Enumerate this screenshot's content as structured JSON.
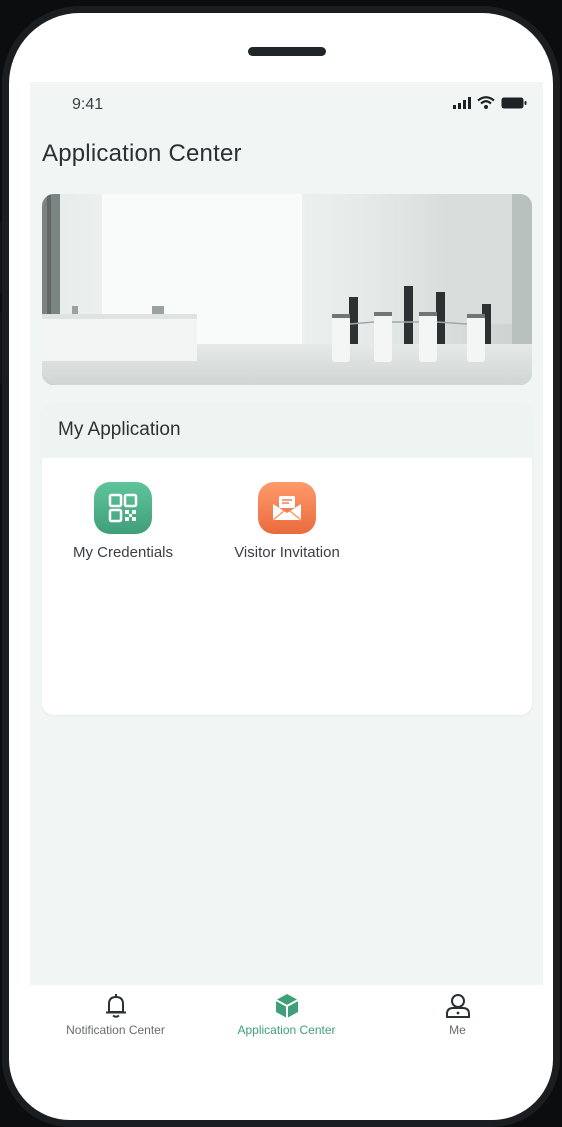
{
  "status_bar": {
    "time": "9:41"
  },
  "header": {
    "title": "Application Center"
  },
  "my_application": {
    "title": "My Application",
    "apps": [
      {
        "label": "My Credentials",
        "icon": "qr-code-icon",
        "color": "#4cb38a"
      },
      {
        "label": "Visitor Invitation",
        "icon": "envelope-icon",
        "color": "#f47c4c"
      }
    ]
  },
  "tabbar": {
    "items": [
      {
        "label": "Notification Center",
        "icon": "bell-icon",
        "active": false
      },
      {
        "label": "Application Center",
        "icon": "cube-icon",
        "active": true
      },
      {
        "label": "Me",
        "icon": "user-icon",
        "active": false
      }
    ]
  },
  "colors": {
    "accent": "#3f9f79",
    "orange": "#f47c4c",
    "screen_bg": "#f1f6f5"
  }
}
